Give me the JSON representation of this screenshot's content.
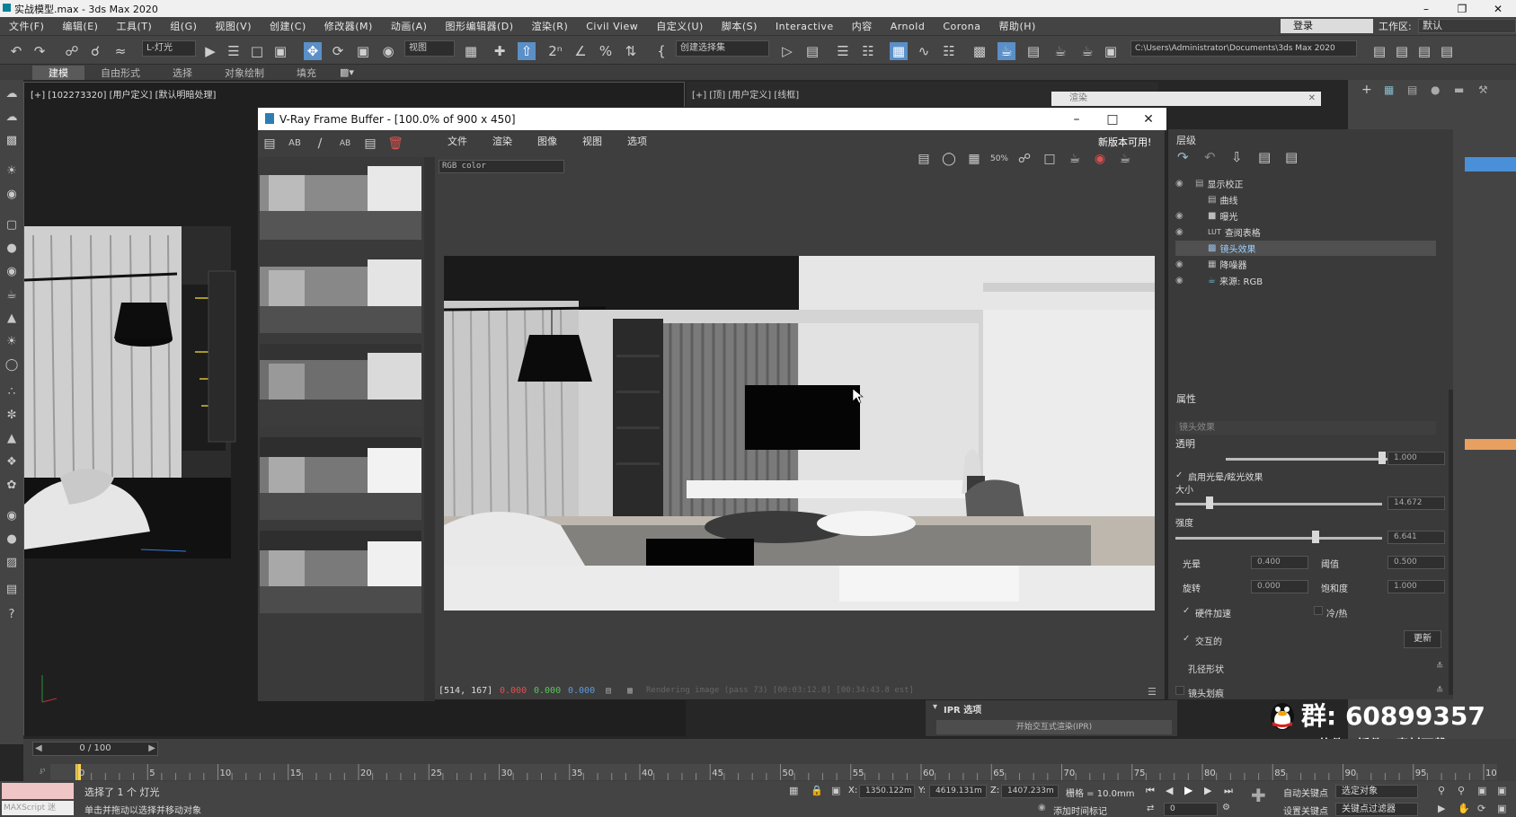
{
  "window": {
    "title": "实战模型.max - 3ds Max 2020"
  },
  "menu": [
    "文件(F)",
    "编辑(E)",
    "工具(T)",
    "组(G)",
    "视图(V)",
    "创建(C)",
    "修改器(M)",
    "动画(A)",
    "图形编辑器(D)",
    "渲染(R)",
    "Civil View",
    "自定义(U)",
    "脚本(S)",
    "Interactive",
    "内容",
    "Arnold",
    "Corona",
    "帮助(H)"
  ],
  "login": "登录",
  "workspace": {
    "label": "工作区:",
    "value": "默认"
  },
  "toolbar": {
    "selection_filter": "L-灯光",
    "view": "视图",
    "named_selection": "创建选择集",
    "path": "C:\\Users\\Administrator\\Documents\\3ds Max 2020"
  },
  "ribbon": [
    "建模",
    "自由形式",
    "选择",
    "对象绘制",
    "填充"
  ],
  "viewport1": {
    "label": "[+] [102273320] [用户定义] [默认明暗处理]"
  },
  "viewport2": {
    "label": "[+] [顶] [用户定义] [线框]"
  },
  "render_setup": {
    "title": "渲染"
  },
  "vfb": {
    "title": "V-Ray Frame Buffer - [100.0% of 900 x 450]",
    "menu": [
      "文件",
      "渲染",
      "图像",
      "视图",
      "选项"
    ],
    "new_version": "新版本可用!",
    "channel": "RGB color",
    "zoom": "50%",
    "status": {
      "coords": "[514, 167]",
      "r": "0.000",
      "g": "0.000",
      "b": "0.000",
      "progress": "Rendering image (pass 73) [00:03:12.8] [00:34:43.8 est]"
    }
  },
  "layers": {
    "header": "层级",
    "items": [
      "显示校正",
      "曲线",
      "曝光",
      "查阅表格",
      "镜头效果",
      "降噪器",
      "来源: RGB"
    ],
    "lut_prefix": "LUT",
    "selected": 4
  },
  "properties": {
    "header": "属性",
    "section": "镜头效果",
    "opacity": {
      "label": "透明",
      "value": "1.000"
    },
    "enable_glare": "启用光晕/眩光效果",
    "size": {
      "label": "大小",
      "value": "14.672"
    },
    "intensity": {
      "label": "强度",
      "value": "6.641"
    },
    "bloom": {
      "label": "光晕",
      "value": "0.400"
    },
    "threshold": {
      "label": "阈值",
      "value": "0.500"
    },
    "rotation": {
      "label": "旋转",
      "value": "0.000"
    },
    "saturation": {
      "label": "饱和度",
      "value": "1.000"
    },
    "hw_accel": "硬件加速",
    "cold_warm": "冷/热",
    "interactive": "交互的",
    "update": "更新",
    "aperture": "孔径形状",
    "lens_scratch": "镜头划痕"
  },
  "ipr": {
    "label": "IPR 选项",
    "start": "开始交互式渲染(IPR)"
  },
  "timeline": {
    "frame": "0 / 100",
    "ticks": [
      "0",
      "5",
      "10",
      "15",
      "20",
      "25",
      "30",
      "35",
      "40",
      "45",
      "50",
      "55",
      "60",
      "65",
      "70",
      "75",
      "80",
      "85",
      "90",
      "95",
      "100"
    ]
  },
  "status": {
    "selected": "选择了 1 个 灯光",
    "hint": "单击并拖动以选择并移动对象",
    "maxscript": "MAXScript 迷",
    "x": "1350.122m",
    "y": "4619.131m",
    "z": "1407.233m",
    "grid": "栅格 = 10.0mm",
    "time_tag": "添加时间标记",
    "autokey": "自动关键点",
    "setkey": "设置关键点",
    "sel_obj": "选定对象",
    "key_filter": "关键点过滤器",
    "frame_num": "0"
  },
  "watermark": {
    "group": "群: 60899357",
    "sub": "( 软件 · 插件 · 素材下载 )"
  }
}
